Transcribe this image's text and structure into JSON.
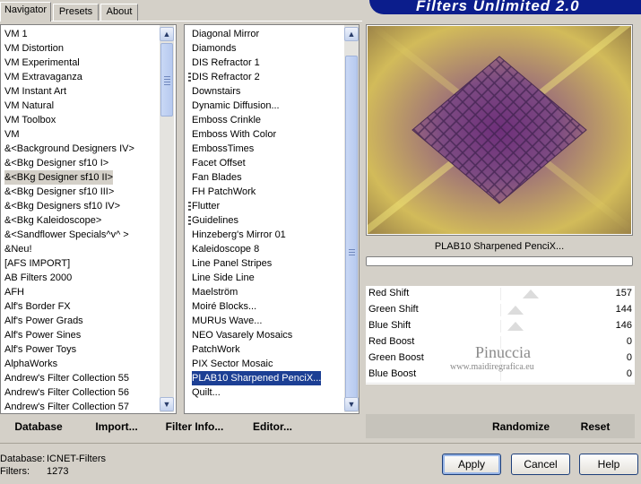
{
  "tabs": [
    "Navigator",
    "Presets",
    "About"
  ],
  "title": "Filters Unlimited 2.0",
  "category_list": [
    "VM 1",
    "VM Distortion",
    "VM Experimental",
    "VM Extravaganza",
    "VM Instant Art",
    "VM Natural",
    "VM Toolbox",
    "VM",
    "&<Background Designers IV>",
    "&<Bkg Designer sf10 I>",
    "&<BKg Designer sf10 II>",
    "&<Bkg Designer sf10 III>",
    "&<Bkg Designers sf10 IV>",
    "&<Bkg Kaleidoscope>",
    "&<Sandflower Specials^v^ >",
    "&Neu!",
    "[AFS IMPORT]",
    "AB Filters 2000",
    "AFH",
    "Alf's Border FX",
    "Alf's Power Grads",
    "Alf's Power Sines",
    "Alf's Power Toys",
    "AlphaWorks",
    "Andrew's Filter Collection 55",
    "Andrew's Filter Collection 56",
    "Andrew's Filter Collection 57"
  ],
  "filter_list": [
    "Diagonal Mirror",
    "Diamonds",
    "DIS Refractor 1",
    "DIS Refractor 2",
    "Downstairs",
    "Dynamic Diffusion...",
    "Emboss Crinkle",
    "Emboss With Color",
    "EmbossTimes",
    "Facet Offset",
    "Fan Blades",
    "FH PatchWork",
    "Flutter",
    "Guidelines",
    "Hinzeberg's Mirror 01",
    "Kaleidoscope 8",
    "Line Panel Stripes",
    "Line Side Line",
    "Maelström",
    "Moiré Blocks...",
    "MURUs Wave...",
    "NEO Vasarely Mosaics",
    "PatchWork",
    "PIX Sector Mosaic",
    "PLAB10 Sharpened PenciX...",
    "Quilt..."
  ],
  "filter_name": "PLAB10 Sharpened PenciX...",
  "params": [
    {
      "name": "Red Shift",
      "value": "157"
    },
    {
      "name": "Green Shift",
      "value": "144"
    },
    {
      "name": "Blue Shift",
      "value": "146"
    },
    {
      "name": "Red Boost",
      "value": "0"
    },
    {
      "name": "Green Boost",
      "value": "0"
    },
    {
      "name": "Blue Boost",
      "value": "0"
    }
  ],
  "watermark": {
    "line1": "Pinuccia",
    "line2": "www.maidiregrafica.eu"
  },
  "toolbar": {
    "database": "Database",
    "import": "Import...",
    "filter_info": "Filter Info...",
    "editor": "Editor...",
    "randomize": "Randomize",
    "reset": "Reset"
  },
  "status": {
    "database_label": "Database:",
    "database_value": "ICNET-Filters",
    "filters_label": "Filters:",
    "filters_value": "1273"
  },
  "buttons": {
    "apply": "Apply",
    "cancel": "Cancel",
    "help": "Help"
  }
}
